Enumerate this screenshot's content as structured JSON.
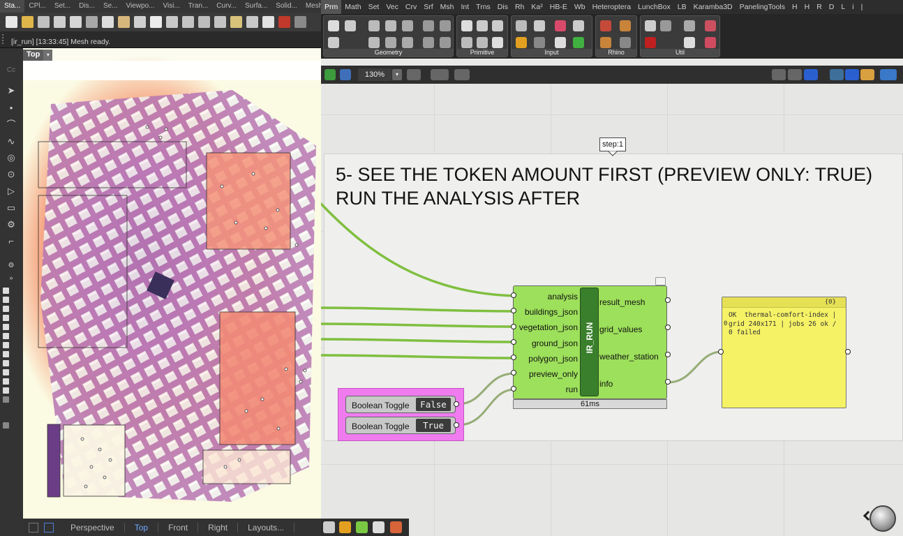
{
  "rhino": {
    "tabs": [
      "Sta...",
      "CPl...",
      "Set...",
      "Dis...",
      "Se...",
      "Viewpo...",
      "Visi...",
      "Tran...",
      "Curv...",
      "Surfa...",
      "Solid...",
      "Mesh"
    ],
    "command_output": "[ir_run] [13:33:45] Mesh ready.",
    "left_field": "Cc",
    "viewport": {
      "name": "Top",
      "dropdown": "▾"
    },
    "bottom_tabs": [
      "Perspective",
      "Top",
      "Front",
      "Right",
      "Layouts..."
    ],
    "active_bottom_tab": "Top",
    "heatmap_colors": {
      "low": "#fbfbe6",
      "mid": "#f7a681",
      "high": "#c06fbf",
      "max": "#6b3d87"
    }
  },
  "grasshopper": {
    "tabs": [
      "Prm",
      "Math",
      "Set",
      "Vec",
      "Crv",
      "Srf",
      "Msh",
      "Int",
      "Trns",
      "Dis",
      "Rh",
      "Ka²",
      "HB-E",
      "Wb",
      "Heteroptera",
      "LunchBox",
      "LB",
      "Karamba3D",
      "PanelingTools",
      "H",
      "H",
      "R",
      "D",
      "L",
      "i",
      "|"
    ],
    "active_tab": "Prm",
    "ribbon_groups": [
      "Geometry",
      "Primitive",
      "Input",
      "Rhino",
      "Util"
    ],
    "zoom": "130%",
    "group_title": "5- SEE THE TOKEN AMOUNT FIRST (PREVIEW ONLY: TRUE)\nRUN THE ANALYSIS AFTER",
    "step_label": "step:1",
    "ir_component": {
      "name": "IR_RUN",
      "inputs": [
        "analysis",
        "buildings_json",
        "vegetation_json",
        "ground_json",
        "polygon_json",
        "preview_only",
        "run"
      ],
      "outputs": [
        "result_mesh",
        "grid_values",
        "weather_station",
        "info"
      ],
      "runtime": "61ms"
    },
    "toggles": [
      {
        "label": "Boolean Toggle",
        "value": "False"
      },
      {
        "label": "Boolean Toggle",
        "value": "True"
      }
    ],
    "panel": {
      "path": "{0}",
      "index": "0",
      "text": "OK  thermal-comfort-index | grid 240x171 | jobs 26 ok / 0 failed"
    },
    "wire_color": "#7fbf3f"
  }
}
